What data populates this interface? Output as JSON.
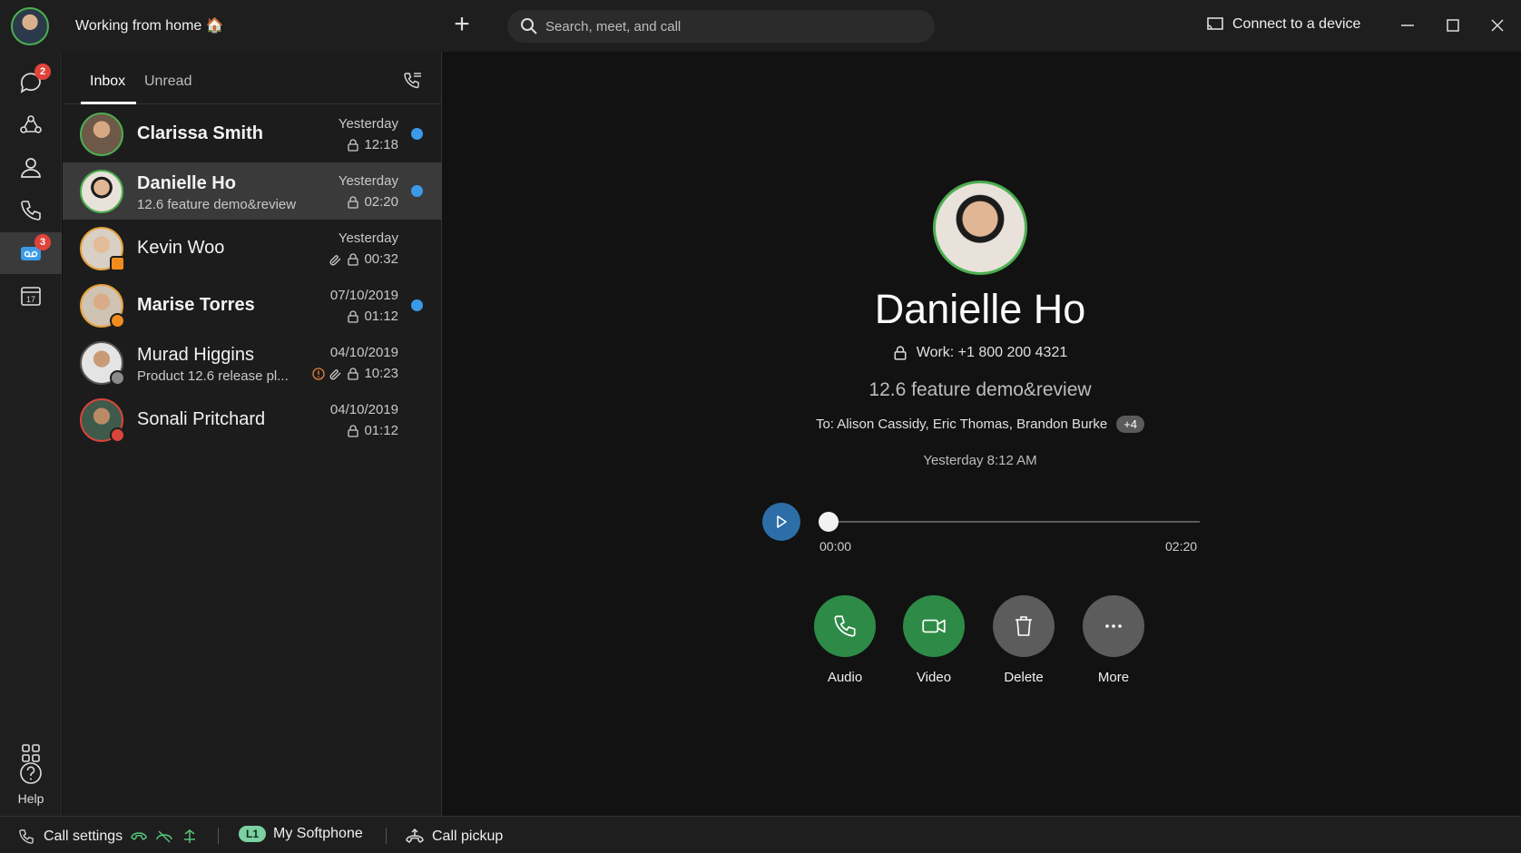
{
  "titlebar": {
    "status": "Working from home 🏠",
    "search_placeholder": "Search, meet, and call",
    "connect_label": "Connect to a device"
  },
  "rail": {
    "messaging_badge": "2",
    "voicemail_badge": "3",
    "calendar_day": "17",
    "help_label": "Help"
  },
  "list": {
    "tabs": [
      "Inbox",
      "Unread"
    ],
    "rows": [
      {
        "name": "Clarissa Smith",
        "subtitle": "",
        "date": "Yesterday",
        "duration": "12:18",
        "unread": true
      },
      {
        "name": "Danielle Ho",
        "subtitle": "12.6 feature demo&review",
        "date": "Yesterday",
        "duration": "02:20",
        "unread": true
      },
      {
        "name": "Kevin Woo",
        "subtitle": "",
        "date": "Yesterday",
        "duration": "00:32",
        "unread": false
      },
      {
        "name": "Marise Torres",
        "subtitle": "",
        "date": "07/10/2019",
        "duration": "01:12",
        "unread": true
      },
      {
        "name": "Murad Higgins",
        "subtitle": "Product 12.6 release pl...",
        "date": "04/10/2019",
        "duration": "10:23",
        "unread": false
      },
      {
        "name": "Sonali Pritchard",
        "subtitle": "",
        "date": "04/10/2019",
        "duration": "01:12",
        "unread": false
      }
    ]
  },
  "detail": {
    "name": "Danielle Ho",
    "work": "Work: +1 800 200 4321",
    "subject": "12.6 feature demo&review",
    "to": "To: Alison Cassidy, Eric Thomas, Brandon Burke",
    "more_recipients": "+4",
    "time": "Yesterday 8:12 AM",
    "player": {
      "start": "00:00",
      "end": "02:20",
      "progress": 0
    },
    "actions": [
      "Audio",
      "Video",
      "Delete",
      "More"
    ]
  },
  "statusbar": {
    "call_settings": "Call settings",
    "line_badge": "L1",
    "softphone": "My Softphone",
    "call_pickup": "Call pickup"
  },
  "colors": {
    "accent_green": "#2e8b47",
    "unread_blue": "#3b9ae8",
    "badge_red": "#e0433a",
    "play_blue": "#2d6ea8"
  }
}
